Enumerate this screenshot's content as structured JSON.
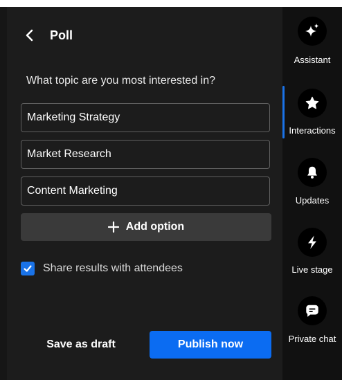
{
  "panel": {
    "title": "Poll",
    "question": "What topic are you most interested in?",
    "options": [
      {
        "value": "Marketing Strategy"
      },
      {
        "value": "Market Research"
      },
      {
        "value": "Content Marketing"
      }
    ],
    "add_option_label": "Add option",
    "share_results": {
      "label": "Share results with attendees",
      "checked": true
    },
    "save_draft_label": "Save as draft",
    "publish_label": "Publish now"
  },
  "rail": {
    "active": "Interactions",
    "items": [
      {
        "label": "Assistant",
        "icon": "sparkle-icon"
      },
      {
        "label": "Interactions",
        "icon": "star-icon"
      },
      {
        "label": "Updates",
        "icon": "bell-icon"
      },
      {
        "label": "Live stage",
        "icon": "lightning-icon"
      },
      {
        "label": "Private chat",
        "icon": "chat-icon"
      }
    ]
  },
  "colors": {
    "accent": "#0b6cf2",
    "panel_bg": "#1c1c1c",
    "rail_bg": "#111111"
  }
}
